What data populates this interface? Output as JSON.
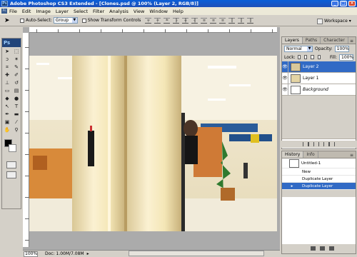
{
  "window": {
    "title": "Adobe Photoshop CS3 Extended - [Clones.psd @ 100% (Layer 2, RGB/8)]",
    "app_icon": "Ps"
  },
  "menubar": [
    "File",
    "Edit",
    "Image",
    "Layer",
    "Select",
    "Filter",
    "Analysis",
    "View",
    "Window",
    "Help"
  ],
  "options": {
    "auto_select_label": "Auto-Select:",
    "auto_select_value": "Group",
    "show_transform_label": "Show Transform Controls",
    "workspace_label": "Workspace"
  },
  "toolbox": {
    "logo": "Ps"
  },
  "status": {
    "zoom": "100%",
    "doc": "Doc: 1.00M/7.08M"
  },
  "layers_panel": {
    "tabs": [
      "Layers",
      "Paths",
      "Character"
    ],
    "blend_mode": "Normal",
    "opacity_label": "Opacity:",
    "opacity": "100%",
    "lock_label": "Lock:",
    "fill_label": "Fill:",
    "fill": "100%",
    "layers": [
      "Layer 2",
      "Layer 1",
      "Background"
    ]
  },
  "history_panel": {
    "tabs": [
      "History",
      "Info"
    ],
    "source": "Untitled-1",
    "states": [
      "New",
      "Duplicate Layer",
      "Duplicate Layer"
    ]
  },
  "colors": {
    "titlebar": "#0a5fd8",
    "selection": "#316ac5"
  }
}
